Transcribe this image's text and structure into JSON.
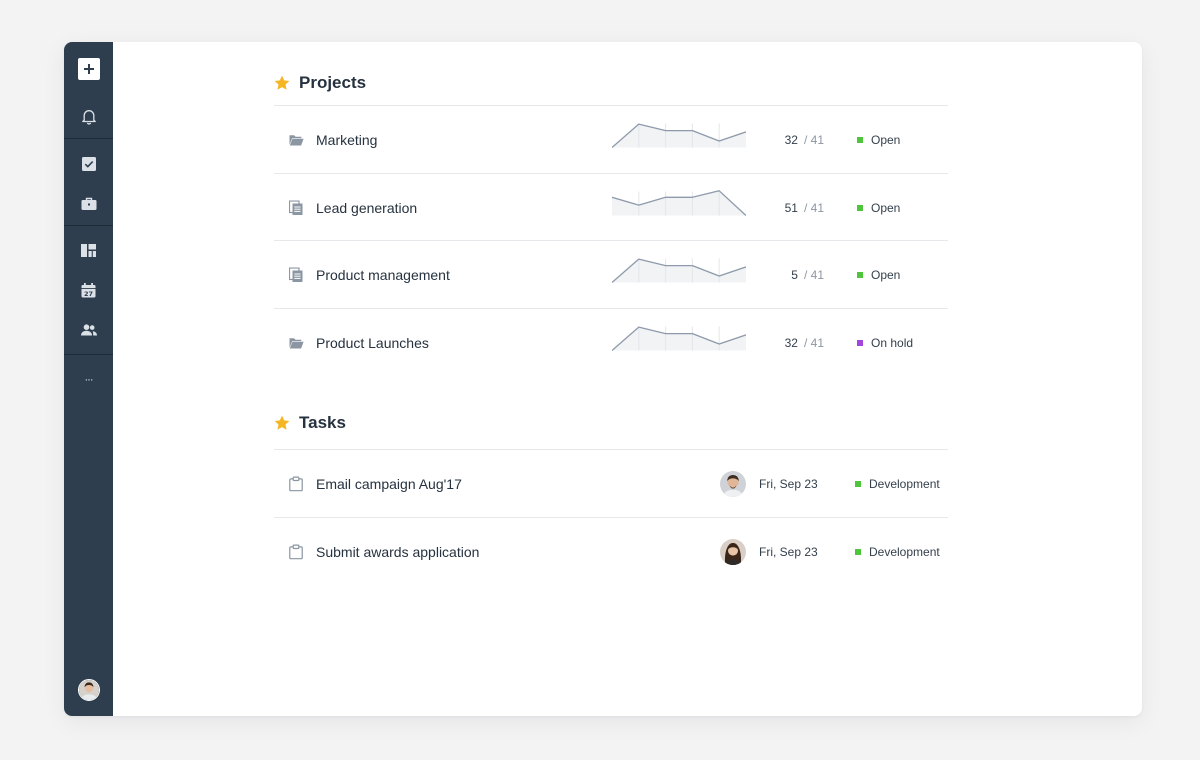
{
  "colors": {
    "sidebar_bg": "#2e3e4e",
    "star": "#f5b623",
    "open": "#4ec53a",
    "on_hold": "#a346dc",
    "development": "#4ec53a"
  },
  "sidebar": {
    "top_icons": [
      "plus-icon",
      "bell-icon"
    ],
    "middle_icons": [
      "checkbox-icon",
      "briefcase-icon",
      "dashboard-icon",
      "calendar-icon",
      "people-icon"
    ],
    "calendar_day": "27",
    "more_label": "···"
  },
  "projects": {
    "title": "Projects",
    "rows": [
      {
        "name": "Marketing",
        "icon": "folder-icon",
        "count": "32",
        "total": "/ 41",
        "status": "Open",
        "status_color": "#4ec53a",
        "trend": [
          0,
          18,
          13,
          13,
          5,
          12
        ]
      },
      {
        "name": "Lead generation",
        "icon": "pages-icon",
        "count": "51",
        "total": "/ 41",
        "status": "Open",
        "status_color": "#4ec53a",
        "trend": [
          14,
          8,
          14,
          14,
          19,
          0
        ]
      },
      {
        "name": "Product management",
        "icon": "pages-icon",
        "count": "5",
        "total": "/ 41",
        "status": "Open",
        "status_color": "#4ec53a",
        "trend": [
          0,
          18,
          13,
          13,
          5,
          12
        ]
      },
      {
        "name": "Product Launches",
        "icon": "folder-icon",
        "count": "32",
        "total": "/ 41",
        "status": "On hold",
        "status_color": "#a346dc",
        "trend": [
          0,
          18,
          13,
          13,
          5,
          12
        ]
      }
    ]
  },
  "tasks": {
    "title": "Tasks",
    "rows": [
      {
        "name": "Email campaign Aug'17",
        "icon": "clipboard-icon",
        "date": "Fri, Sep 23",
        "status": "Development",
        "status_color": "#4ec53a"
      },
      {
        "name": "Submit awards application",
        "icon": "clipboard-icon",
        "date": "Fri, Sep 23",
        "status": "Development",
        "status_color": "#4ec53a"
      }
    ]
  }
}
